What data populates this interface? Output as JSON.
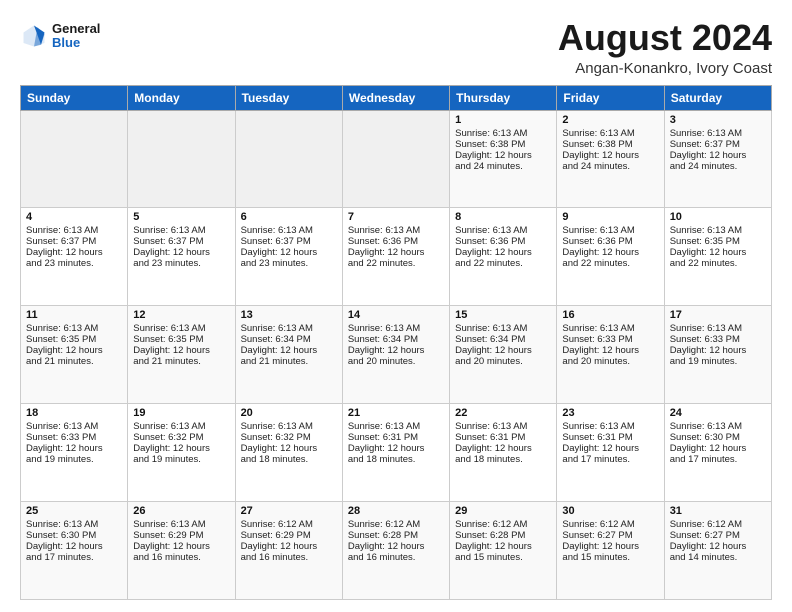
{
  "header": {
    "logo_line1": "General",
    "logo_line2": "Blue",
    "main_title": "August 2024",
    "subtitle": "Angan-Konankro, Ivory Coast"
  },
  "calendar": {
    "days_of_week": [
      "Sunday",
      "Monday",
      "Tuesday",
      "Wednesday",
      "Thursday",
      "Friday",
      "Saturday"
    ],
    "weeks": [
      [
        {
          "day": "",
          "content": ""
        },
        {
          "day": "",
          "content": ""
        },
        {
          "day": "",
          "content": ""
        },
        {
          "day": "",
          "content": ""
        },
        {
          "day": "1",
          "content": "Sunrise: 6:13 AM\nSunset: 6:38 PM\nDaylight: 12 hours\nand 24 minutes."
        },
        {
          "day": "2",
          "content": "Sunrise: 6:13 AM\nSunset: 6:38 PM\nDaylight: 12 hours\nand 24 minutes."
        },
        {
          "day": "3",
          "content": "Sunrise: 6:13 AM\nSunset: 6:37 PM\nDaylight: 12 hours\nand 24 minutes."
        }
      ],
      [
        {
          "day": "4",
          "content": "Sunrise: 6:13 AM\nSunset: 6:37 PM\nDaylight: 12 hours\nand 23 minutes."
        },
        {
          "day": "5",
          "content": "Sunrise: 6:13 AM\nSunset: 6:37 PM\nDaylight: 12 hours\nand 23 minutes."
        },
        {
          "day": "6",
          "content": "Sunrise: 6:13 AM\nSunset: 6:37 PM\nDaylight: 12 hours\nand 23 minutes."
        },
        {
          "day": "7",
          "content": "Sunrise: 6:13 AM\nSunset: 6:36 PM\nDaylight: 12 hours\nand 22 minutes."
        },
        {
          "day": "8",
          "content": "Sunrise: 6:13 AM\nSunset: 6:36 PM\nDaylight: 12 hours\nand 22 minutes."
        },
        {
          "day": "9",
          "content": "Sunrise: 6:13 AM\nSunset: 6:36 PM\nDaylight: 12 hours\nand 22 minutes."
        },
        {
          "day": "10",
          "content": "Sunrise: 6:13 AM\nSunset: 6:35 PM\nDaylight: 12 hours\nand 22 minutes."
        }
      ],
      [
        {
          "day": "11",
          "content": "Sunrise: 6:13 AM\nSunset: 6:35 PM\nDaylight: 12 hours\nand 21 minutes."
        },
        {
          "day": "12",
          "content": "Sunrise: 6:13 AM\nSunset: 6:35 PM\nDaylight: 12 hours\nand 21 minutes."
        },
        {
          "day": "13",
          "content": "Sunrise: 6:13 AM\nSunset: 6:34 PM\nDaylight: 12 hours\nand 21 minutes."
        },
        {
          "day": "14",
          "content": "Sunrise: 6:13 AM\nSunset: 6:34 PM\nDaylight: 12 hours\nand 20 minutes."
        },
        {
          "day": "15",
          "content": "Sunrise: 6:13 AM\nSunset: 6:34 PM\nDaylight: 12 hours\nand 20 minutes."
        },
        {
          "day": "16",
          "content": "Sunrise: 6:13 AM\nSunset: 6:33 PM\nDaylight: 12 hours\nand 20 minutes."
        },
        {
          "day": "17",
          "content": "Sunrise: 6:13 AM\nSunset: 6:33 PM\nDaylight: 12 hours\nand 19 minutes."
        }
      ],
      [
        {
          "day": "18",
          "content": "Sunrise: 6:13 AM\nSunset: 6:33 PM\nDaylight: 12 hours\nand 19 minutes."
        },
        {
          "day": "19",
          "content": "Sunrise: 6:13 AM\nSunset: 6:32 PM\nDaylight: 12 hours\nand 19 minutes."
        },
        {
          "day": "20",
          "content": "Sunrise: 6:13 AM\nSunset: 6:32 PM\nDaylight: 12 hours\nand 18 minutes."
        },
        {
          "day": "21",
          "content": "Sunrise: 6:13 AM\nSunset: 6:31 PM\nDaylight: 12 hours\nand 18 minutes."
        },
        {
          "day": "22",
          "content": "Sunrise: 6:13 AM\nSunset: 6:31 PM\nDaylight: 12 hours\nand 18 minutes."
        },
        {
          "day": "23",
          "content": "Sunrise: 6:13 AM\nSunset: 6:31 PM\nDaylight: 12 hours\nand 17 minutes."
        },
        {
          "day": "24",
          "content": "Sunrise: 6:13 AM\nSunset: 6:30 PM\nDaylight: 12 hours\nand 17 minutes."
        }
      ],
      [
        {
          "day": "25",
          "content": "Sunrise: 6:13 AM\nSunset: 6:30 PM\nDaylight: 12 hours\nand 17 minutes."
        },
        {
          "day": "26",
          "content": "Sunrise: 6:13 AM\nSunset: 6:29 PM\nDaylight: 12 hours\nand 16 minutes."
        },
        {
          "day": "27",
          "content": "Sunrise: 6:12 AM\nSunset: 6:29 PM\nDaylight: 12 hours\nand 16 minutes."
        },
        {
          "day": "28",
          "content": "Sunrise: 6:12 AM\nSunset: 6:28 PM\nDaylight: 12 hours\nand 16 minutes."
        },
        {
          "day": "29",
          "content": "Sunrise: 6:12 AM\nSunset: 6:28 PM\nDaylight: 12 hours\nand 15 minutes."
        },
        {
          "day": "30",
          "content": "Sunrise: 6:12 AM\nSunset: 6:27 PM\nDaylight: 12 hours\nand 15 minutes."
        },
        {
          "day": "31",
          "content": "Sunrise: 6:12 AM\nSunset: 6:27 PM\nDaylight: 12 hours\nand 14 minutes."
        }
      ]
    ]
  }
}
